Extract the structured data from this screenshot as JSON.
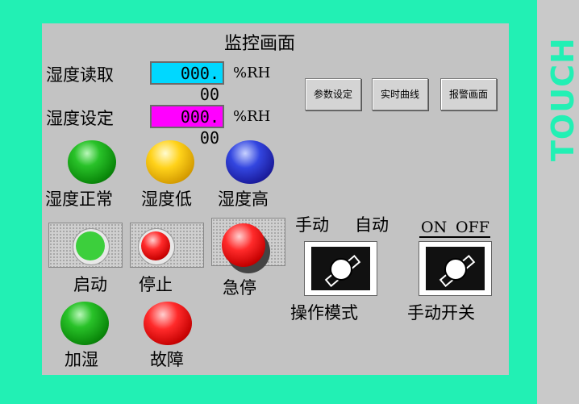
{
  "brand": {
    "text": "TOUCH"
  },
  "screen": {
    "title": "监控画面",
    "humidity_read": {
      "label": "湿度读取",
      "value": "000. 00",
      "unit": "%RH",
      "color": "#00d8ff"
    },
    "humidity_set": {
      "label": "湿度设定",
      "value": "000. 00",
      "unit": "%RH",
      "color": "#ff00ff"
    },
    "nav_buttons": [
      {
        "label": "参数设定"
      },
      {
        "label": "实时曲线"
      },
      {
        "label": "报警画面"
      }
    ],
    "status_lamps": [
      {
        "label": "湿度正常",
        "color": "green"
      },
      {
        "label": "湿度低",
        "color": "yellow"
      },
      {
        "label": "湿度高",
        "color": "blue"
      }
    ],
    "control_buttons": [
      {
        "label": "启动",
        "color": "green"
      },
      {
        "label": "停止",
        "color": "red"
      },
      {
        "label": "急停",
        "color": "red"
      }
    ],
    "mode_switch": {
      "left_label": "手动",
      "right_label": "自动",
      "label": "操作模式"
    },
    "manual_switch": {
      "left_label": "ON",
      "right_label": "OFF",
      "label": "手动开关"
    },
    "output_lamps": [
      {
        "label": "加湿",
        "color": "green"
      },
      {
        "label": "故障",
        "color": "red"
      }
    ],
    "colors": {
      "bezel": "#22f0b4",
      "screen": "#c3c3c3"
    }
  }
}
